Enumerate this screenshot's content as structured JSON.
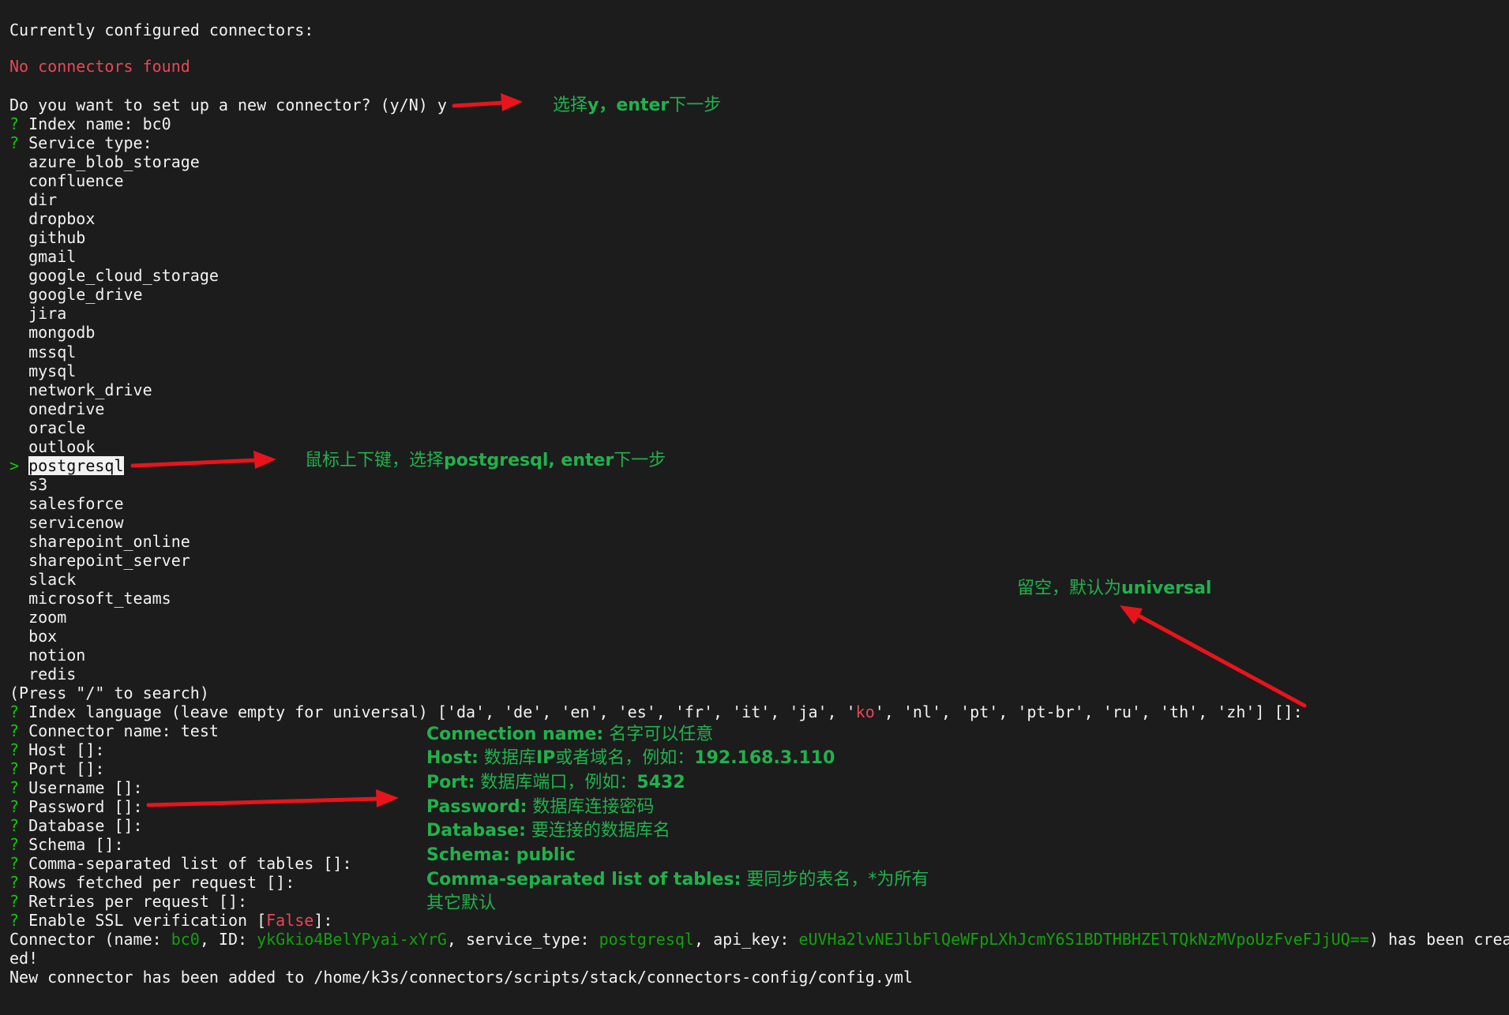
{
  "terminal": {
    "header": "Currently configured connectors:",
    "no_connectors": "No connectors found",
    "setup_prompt": "Do you want to set up a new connector? (y/N) y",
    "q_mark": "?",
    "sel_mark": ">",
    "index_name": "Index name: bc0",
    "service_type": "Service type:",
    "services": [
      "azure_blob_storage",
      "confluence",
      "dir",
      "dropbox",
      "github",
      "gmail",
      "google_cloud_storage",
      "google_drive",
      "jira",
      "mongodb",
      "mssql",
      "mysql",
      "network_drive",
      "onedrive",
      "oracle",
      "outlook",
      "postgresql",
      "s3",
      "salesforce",
      "servicenow",
      "sharepoint_online",
      "sharepoint_server",
      "slack",
      "microsoft_teams",
      "zoom",
      "box",
      "notion",
      "redis"
    ],
    "selected_service": "postgresql",
    "search_hint": "(Press \"/\" to search)",
    "index_language_a": "Index language (leave empty for universal) ['da', 'de', 'en', 'es', 'fr', 'it', 'ja', '",
    "index_language_ko": "ko",
    "index_language_b": "', 'nl', 'pt', 'pt-br', 'ru', 'th', 'zh'] []:",
    "fields": [
      "Connector name: test",
      "Host []:",
      "Port []:",
      "Username []:",
      "Password []:",
      "Database []:",
      "Schema []:",
      "Comma-separated list of tables []:",
      "Rows fetched per request []:",
      "Retries per request []:"
    ],
    "ssl_a": "Enable SSL verification [",
    "ssl_false": "False",
    "ssl_b": "]:",
    "created": {
      "p1": "Connector (name: ",
      "name": "bc0",
      "p2": ", ID: ",
      "id": "ykGkio4BelYPyai-xYrG",
      "p3": ", service_type: ",
      "service_type": "postgresql",
      "p4": ", api_key: ",
      "api_key": "eUVHa2lvNEJlbFlQeWFpLXhJcmY6S1BDTHBHZElTQkNzMVpoUzFveFJjUQ==",
      "p5": ") has been crea"
    },
    "created_cont": "ed!",
    "added": "New connector has been added to /home/k3s/connectors/scripts/stack/connectors-config/config.yml"
  },
  "annotations": {
    "select_y": {
      "a": "选择",
      "b": "y，enter",
      "c": "下一步"
    },
    "select_pg": {
      "a": "鼠标上下键，选择",
      "b": "postgresql, enter",
      "c": "下一步"
    },
    "lang_empty": {
      "a": "留空，默认为",
      "b": "universal"
    },
    "conn_name": {
      "k": "Connection name:",
      "v": " 名字可以任意"
    },
    "host": {
      "k": "Host:",
      "v": " 数据库",
      "k2": "IP",
      "v2": "或者域名，例如：",
      "k3": "192.168.3.110"
    },
    "port": {
      "k": "Port:",
      "v": " 数据库端口，例如：",
      "k2": "5432"
    },
    "password": {
      "k": "Password:",
      "v": " 数据库连接密码"
    },
    "database": {
      "k": "Database:",
      "v": " 要连接的数据库名"
    },
    "schema": {
      "k": "Schema: public"
    },
    "tables": {
      "k": "Comma-separated list of tables:",
      "v": " 要同步的表名，*为所有"
    },
    "others": "其它默认"
  },
  "colors": {
    "background": "#1c1c1c",
    "prompt_green": "#16c60c",
    "error_red": "#e74856",
    "value_cyan": "#3a96dd",
    "annotation_green": "#22b14c",
    "arrow_red": "#e8141c"
  }
}
